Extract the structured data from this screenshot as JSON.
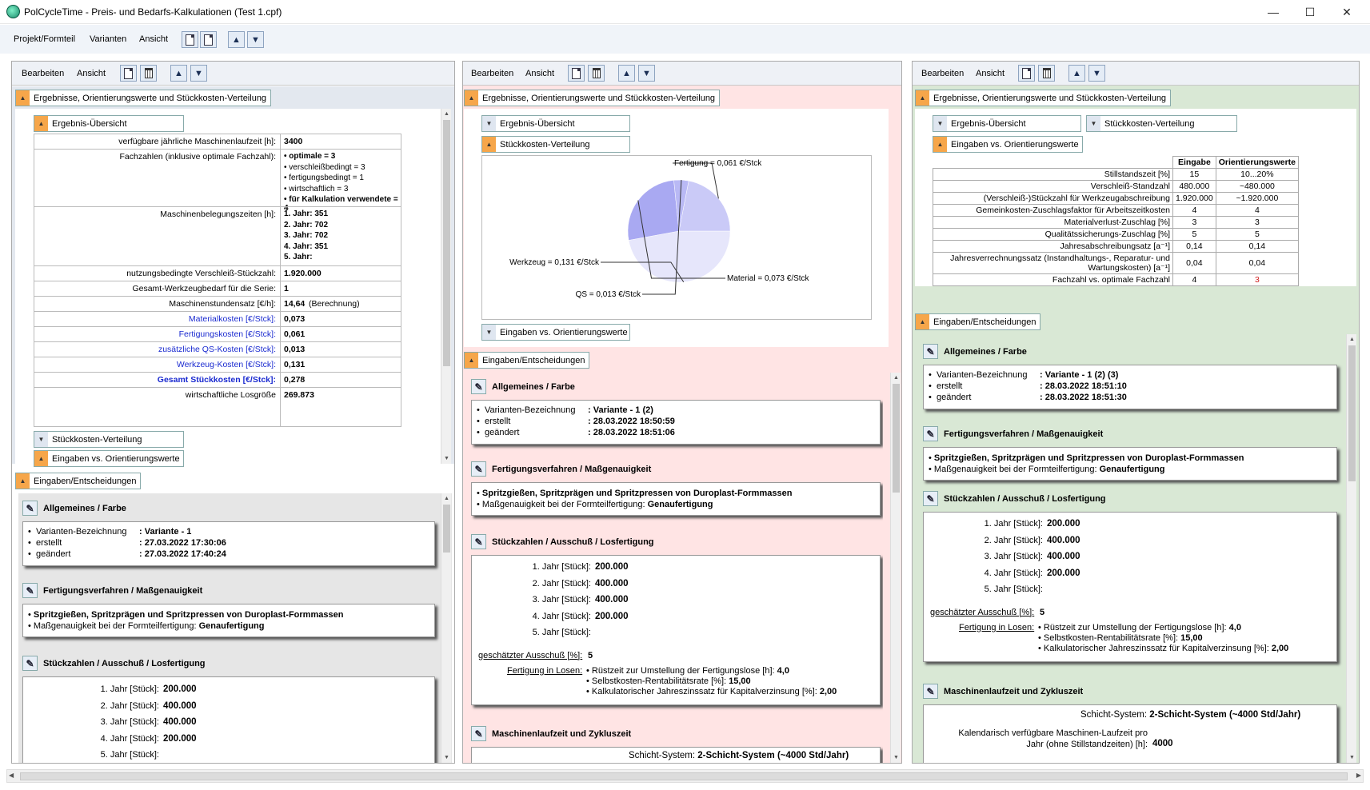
{
  "window": {
    "title": "PolCycleTime - Preis- und Bedarfs-Kalkulationen (Test 1.cpf)"
  },
  "menubar": {
    "items": [
      "Projekt/Formteil",
      "Varianten",
      "Ansicht"
    ]
  },
  "panel": {
    "menu_edit": "Bearbeiten",
    "menu_view": "Ansicht"
  },
  "sections": {
    "results": "Ergebnisse, Orientierungswerte und Stückkosten-Verteilung",
    "overview": "Ergebnis-Übersicht",
    "distribution": "Stückkosten-Verteilung",
    "orientation": "Eingaben vs. Orientierungswerte",
    "inputs": "Eingaben/Entscheidungen",
    "general": "Allgemeines / Farbe",
    "process": "Fertigungsverfahren / Maßgenauigkeit",
    "quantities": "Stückzahlen / Ausschuß / Losfertigung",
    "machine": "Maschinenlaufzeit und Zykluszeit"
  },
  "general_labels": {
    "name": "Varianten-Bezeichnung",
    "created": "erstellt",
    "changed": "geändert"
  },
  "process": {
    "line1": "Spritzgießen, Spritzprägen und Spritzpressen von Duroplast-Formmassen",
    "line2_label": "Maßgenauigkeit bei der Formteilfertigung:",
    "line2_value": "Genaufertigung"
  },
  "quantities": {
    "years": [
      {
        "label": "1. Jahr [Stück]:",
        "value": "200.000"
      },
      {
        "label": "2. Jahr [Stück]:",
        "value": "400.000"
      },
      {
        "label": "3. Jahr [Stück]:",
        "value": "400.000"
      },
      {
        "label": "4. Jahr [Stück]:",
        "value": "200.000"
      },
      {
        "label": "5. Jahr [Stück]:",
        "value": ""
      }
    ],
    "scrap_label": "geschätzter Ausschuß [%]:",
    "scrap_value": "5",
    "lots_label": "Fertigung in Losen:",
    "lots": [
      {
        "label": "Rüstzeit zur Umstellung der Fertigungslose [h]:",
        "value": "4,0"
      },
      {
        "label": "Selbstkosten-Rentabilitätsrate [%]:",
        "value": "15,00"
      },
      {
        "label": "Kalkulatorischer Jahreszinssatz für Kapitalverzinsung [%]:",
        "value": "2,00"
      }
    ]
  },
  "machine": {
    "shift_label": "Schicht-System:",
    "shift_value": "2-Schicht-System (~4000 Std/Jahr)",
    "avail_label1": "Kalendarisch verfügbare Maschinen-Laufzeit pro",
    "avail_label2": "Jahr (ohne Stillstandzeiten) [h]:",
    "avail_value": "4000"
  },
  "left": {
    "general": {
      "name": "Variante - 1",
      "created": "27.03.2022 17:30:06",
      "changed": "27.03.2022 17:40:24"
    },
    "overview": [
      {
        "label": "verfügbare jährliche Maschinenlaufzeit [h]:",
        "values": [
          "3400"
        ]
      },
      {
        "label": "Fachzahlen (inklusive optimale Fachzahl):",
        "values": [
          "• optimale = 3",
          "• verschleißbedingt = 3",
          "• fertigungsbedingt = 1",
          "• wirtschaftlich = 3",
          "• für Kalkulation verwendete = 4"
        ]
      },
      {
        "label": "Maschinenbelegungszeiten [h]:",
        "values": [
          "1. Jahr: 351",
          "2. Jahr: 702",
          "3. Jahr: 702",
          "4. Jahr: 351",
          "5. Jahr:"
        ]
      },
      {
        "label": "nutzungsbedingte Verschleiß-Stückzahl:",
        "values": [
          "1.920.000"
        ]
      },
      {
        "label": "Gesamt-Werkzeugbedarf für die Serie:",
        "values": [
          "1"
        ]
      },
      {
        "label": "Maschinenstundensatz [€/h]:",
        "values": [
          "14,64"
        ],
        "note": "(Berechnung)"
      },
      {
        "label": "Materialkosten [€/Stck]:",
        "values": [
          "0,073"
        ],
        "blue": true
      },
      {
        "label": "Fertigungskosten [€/Stck]:",
        "values": [
          "0,061"
        ],
        "blue": true
      },
      {
        "label": "zusätzliche QS-Kosten [€/Stck]:",
        "values": [
          "0,013"
        ],
        "blue": true
      },
      {
        "label": "Werkzeug-Kosten [€/Stck]:",
        "values": [
          "0,131"
        ],
        "blue": true
      },
      {
        "label": "Gesamt Stückkosten [€/Stck]:",
        "values": [
          "0,278"
        ],
        "blue": true,
        "bold": true
      },
      {
        "label": "wirtschaftliche Losgröße",
        "values": [
          "269.873"
        ]
      }
    ]
  },
  "middle": {
    "general": {
      "name": "Variante - 1 (2)",
      "created": "28.03.2022 18:50:59",
      "changed": "28.03.2022 18:51:06"
    },
    "pie": {
      "slices": [
        {
          "label": "Werkzeug = 0,131 €/Stck",
          "value": 0.131,
          "color": "#e6e6fb"
        },
        {
          "label": "Material = 0,073 €/Stck",
          "value": 0.073,
          "color": "#a9a9f2"
        },
        {
          "label": "QS = 0,013 €/Stck",
          "value": 0.013,
          "color": "#b9b9f5"
        },
        {
          "label": "Fertigung = 0,061 €/Stck",
          "value": 0.061,
          "color": "#cacaf7"
        }
      ]
    }
  },
  "right": {
    "general": {
      "name": "Variante - 1 (2) (3)",
      "created": "28.03.2022 18:51:10",
      "changed": "28.03.2022 18:51:30"
    },
    "table": {
      "headers": [
        "",
        "Eingabe",
        "Orientierungswerte"
      ],
      "rows": [
        [
          "Stillstandszeit [%]",
          "15",
          "10...20%"
        ],
        [
          "Verschleiß-Standzahl",
          "480.000",
          "~480.000"
        ],
        [
          "(Verschleiß-)Stückzahl für Werkzeugabschreibung",
          "1.920.000",
          "~1.920.000"
        ],
        [
          "Gemeinkosten-Zuschlagsfaktor für Arbeitszeitkosten",
          "4",
          "4"
        ],
        [
          "Materialverlust-Zuschlag [%]",
          "3",
          "3"
        ],
        [
          "Qualitätssicherungs-Zuschlag [%]",
          "5",
          "5"
        ],
        [
          "Jahresabschreibungsatz [a⁻¹]",
          "0,14",
          "0,14"
        ],
        [
          "Jahresverrechnungssatz (Instandhaltungs-, Reparatur- und Wartungskosten) [a⁻¹]",
          "0,04",
          "0,04"
        ],
        [
          "Fachzahl vs. optimale Fachzahl",
          "4",
          "3"
        ]
      ]
    }
  }
}
